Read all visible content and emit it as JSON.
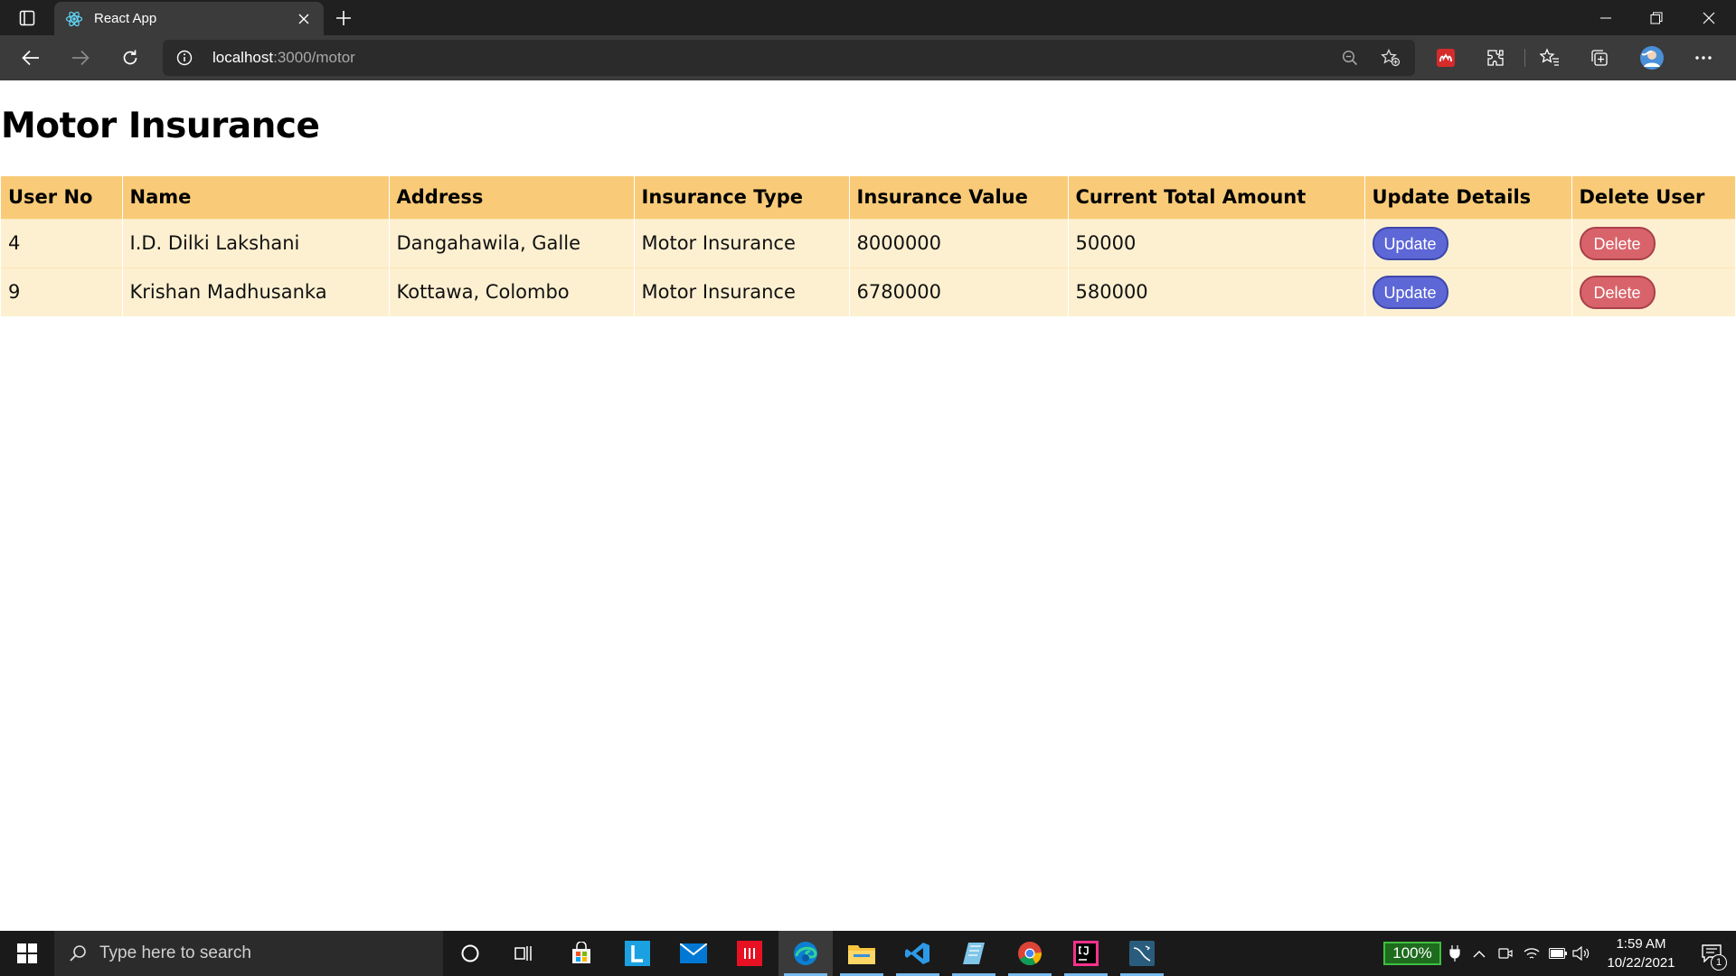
{
  "browser": {
    "tab_title": "React App",
    "url_host": "localhost",
    "url_path": ":3000/motor"
  },
  "page": {
    "title": "Motor Insurance"
  },
  "table": {
    "headers": [
      "User No",
      "Name",
      "Address",
      "Insurance Type",
      "Insurance Value",
      "Current Total Amount",
      "Update Details",
      "Delete User"
    ],
    "rows": [
      {
        "user_no": "4",
        "name": "I.D. Dilki Lakshani",
        "address": "Dangahawila, Galle",
        "insurance_type": "Motor Insurance",
        "insurance_value": "8000000",
        "current_total_amount": "50000",
        "update_label": "Update",
        "delete_label": "Delete"
      },
      {
        "user_no": "9",
        "name": "Krishan Madhusanka",
        "address": "Kottawa, Colombo",
        "insurance_type": "Motor Insurance",
        "insurance_value": "6780000",
        "current_total_amount": "580000",
        "update_label": "Update",
        "delete_label": "Delete"
      }
    ]
  },
  "taskbar": {
    "search_placeholder": "Type here to search",
    "battery": "100%",
    "time": "1:59 AM",
    "date": "10/22/2021",
    "notification_count": "1"
  },
  "colors": {
    "header_bg": "#f9cb78",
    "row_bg": "#fdf0d1",
    "update_button": "#5d67d6",
    "delete_button": "#d9636a"
  }
}
